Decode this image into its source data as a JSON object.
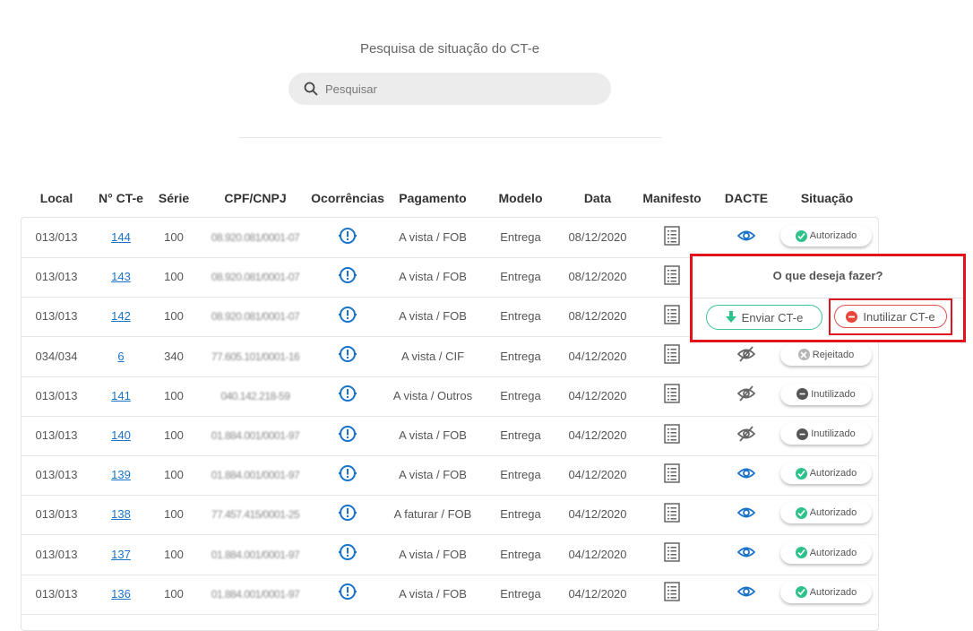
{
  "page": {
    "title": "Pesquisa de situação do CT-e",
    "search_placeholder": "Pesquisar"
  },
  "table": {
    "headers": [
      "Local",
      "N° CT-e",
      "Série",
      "CPF/CNPJ",
      "Ocorrências",
      "Pagamento",
      "Modelo",
      "Data",
      "Manifesto",
      "DACTE",
      "Situação"
    ],
    "rows": [
      {
        "local": "013/013",
        "num": "144",
        "serie": "100",
        "doc": "08.920.081/0001-07",
        "pagamento": "A vista / FOB",
        "modelo": "Entrega",
        "data": "08/12/2020",
        "dacte": "visible",
        "situacao": "Autorizado",
        "status": "ok"
      },
      {
        "local": "013/013",
        "num": "143",
        "serie": "100",
        "doc": "08.920.081/0001-07",
        "pagamento": "A vista / FOB",
        "modelo": "Entrega",
        "data": "08/12/2020",
        "dacte": "visible",
        "situacao": "",
        "status": ""
      },
      {
        "local": "013/013",
        "num": "142",
        "serie": "100",
        "doc": "08.920.081/0001-07",
        "pagamento": "A vista / FOB",
        "modelo": "Entrega",
        "data": "08/12/2020",
        "dacte": "visible",
        "situacao": "",
        "status": ""
      },
      {
        "local": "034/034",
        "num": "6",
        "serie": "340",
        "doc": "77.605.101/0001-16",
        "pagamento": "A vista / CIF",
        "modelo": "Entrega",
        "data": "04/12/2020",
        "dacte": "hidden",
        "situacao": "Rejeitado",
        "status": "rej"
      },
      {
        "local": "013/013",
        "num": "141",
        "serie": "100",
        "doc": "040.142.218-59",
        "pagamento": "A vista / Outros",
        "modelo": "Entrega",
        "data": "04/12/2020",
        "dacte": "hidden",
        "situacao": "Inutilizado",
        "status": "inut"
      },
      {
        "local": "013/013",
        "num": "140",
        "serie": "100",
        "doc": "01.884.001/0001-97",
        "pagamento": "A vista / FOB",
        "modelo": "Entrega",
        "data": "04/12/2020",
        "dacte": "hidden",
        "situacao": "Inutilizado",
        "status": "inut"
      },
      {
        "local": "013/013",
        "num": "139",
        "serie": "100",
        "doc": "01.884.001/0001-97",
        "pagamento": "A vista / FOB",
        "modelo": "Entrega",
        "data": "04/12/2020",
        "dacte": "visible",
        "situacao": "Autorizado",
        "status": "ok"
      },
      {
        "local": "013/013",
        "num": "138",
        "serie": "100",
        "doc": "77.457.415/0001-25",
        "pagamento": "A faturar / FOB",
        "modelo": "Entrega",
        "data": "04/12/2020",
        "dacte": "visible",
        "situacao": "Autorizado",
        "status": "ok"
      },
      {
        "local": "013/013",
        "num": "137",
        "serie": "100",
        "doc": "01.884.001/0001-97",
        "pagamento": "A vista / FOB",
        "modelo": "Entrega",
        "data": "04/12/2020",
        "dacte": "visible",
        "situacao": "Autorizado",
        "status": "ok"
      },
      {
        "local": "013/013",
        "num": "136",
        "serie": "100",
        "doc": "01.884.001/0001-97",
        "pagamento": "A vista / FOB",
        "modelo": "Entrega",
        "data": "04/12/2020",
        "dacte": "visible",
        "situacao": "Autorizado",
        "status": "ok"
      }
    ]
  },
  "popup": {
    "question": "O que deseja fazer?",
    "send_label": "Enviar CT-e",
    "inutilize_label": "Inutilizar CT-e"
  },
  "colors": {
    "accent_blue": "#1a73c8",
    "ok_green": "#2ec28a",
    "danger_red": "#e0141e",
    "rejected_grey": "#b5b5b5",
    "inutil_dark": "#555555"
  },
  "icons": {
    "search": "search-icon",
    "ocorrencia": "alert-circle-icon",
    "manifesto": "document-list-icon",
    "dacte_visible": "eye-icon",
    "dacte_hidden": "eye-off-icon"
  }
}
